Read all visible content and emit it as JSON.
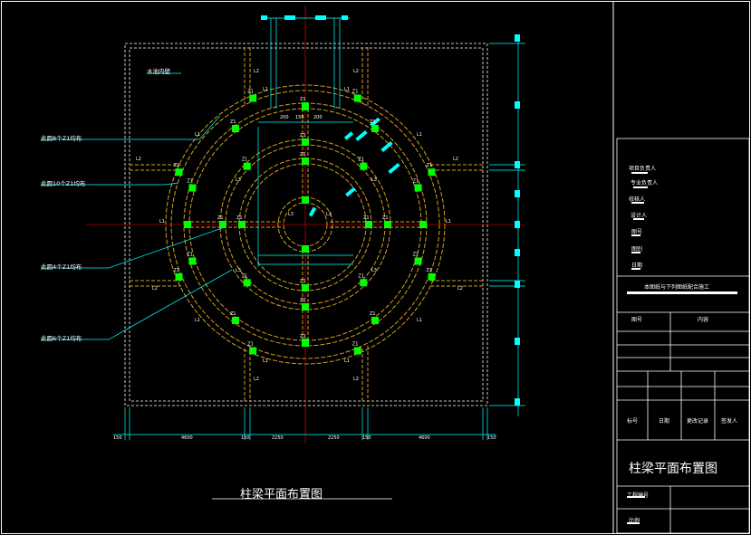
{
  "drawing": {
    "title": "柱梁平面布置图",
    "pool_label": "水池内壁",
    "notes": [
      "此圆8个Z1均布",
      "此圆10个Z1均布",
      "此圆4个Z1均布",
      "此圆6个Z1均布"
    ],
    "column_label": "Z1",
    "beam_labels": [
      "L1",
      "L2",
      "L3"
    ],
    "bottom_dimensions": [
      "150",
      "4600",
      "150",
      "2250",
      "2250",
      "150",
      "4600",
      "150"
    ],
    "small_dimensions": [
      "200",
      "150",
      "200"
    ],
    "colors": {
      "background": "#000000",
      "beam": "#d4a020",
      "column": "#00ff00",
      "axis": "#ff0000",
      "dimension": "#00ffff",
      "frame": "#ffffff"
    }
  },
  "title_block": {
    "roles": [
      "项目负责人",
      "专业负责人",
      "校核人",
      "设计人",
      "图号",
      "图别",
      "日期"
    ],
    "stamp_note": "本图纸与下列图纸配合施工",
    "table_headers": [
      "图号",
      "内容"
    ],
    "revision_headers": [
      "标号",
      "日期",
      "更改记录",
      "签发人"
    ],
    "drawing_title": "柱梁平面布置图",
    "project_no_label": "工程编号",
    "scale_label": "比例"
  }
}
